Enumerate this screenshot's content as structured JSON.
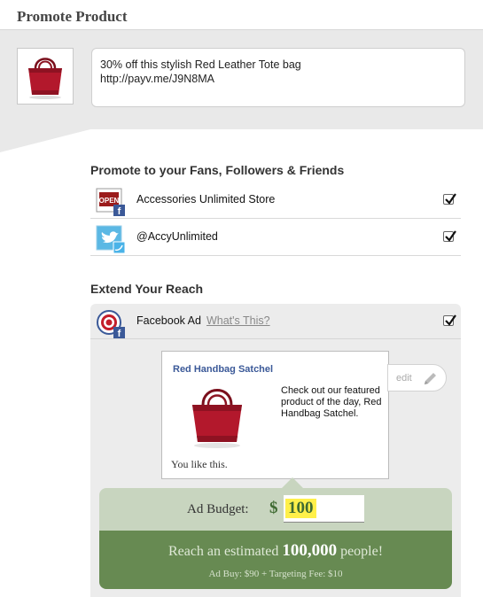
{
  "page": {
    "title": "Promote Product"
  },
  "compose": {
    "message_line1": "30% off this stylish Red Leather Tote bag",
    "message_line2": "http://payv.me/J9N8MA"
  },
  "fans_section": {
    "heading": "Promote to your Fans, Followers & Friends",
    "channels": [
      {
        "label": "Accessories Unlimited Store",
        "icon": "store-facebook-icon",
        "checked": true
      },
      {
        "label": "@AccyUnlimited",
        "icon": "twitter-icon",
        "checked": true
      }
    ]
  },
  "reach_section": {
    "heading": "Extend Your Reach",
    "facebook_ad": {
      "label": "Facebook Ad",
      "whats_this": "What's This?",
      "checked": true,
      "icon": "facebook-target-icon"
    },
    "ad_preview": {
      "title": "Red Handbag Satchel",
      "text": "Check out our featured product of the day, Red Handbag Satchel.",
      "like_text": "You like this.",
      "edit_label": "edit"
    },
    "budget": {
      "label": "Ad Budget:",
      "currency": "$",
      "value": "100"
    },
    "reach": {
      "prefix": "Reach an estimated",
      "number": "100,000",
      "suffix": "people!",
      "fees": "Ad Buy: $90 + Targeting Fee: $10"
    }
  },
  "colors": {
    "facebook_blue": "#3b5998",
    "budget_green_light": "#c8d5bf",
    "budget_green_dark": "#678a52",
    "highlight_yellow": "#fff04a"
  }
}
